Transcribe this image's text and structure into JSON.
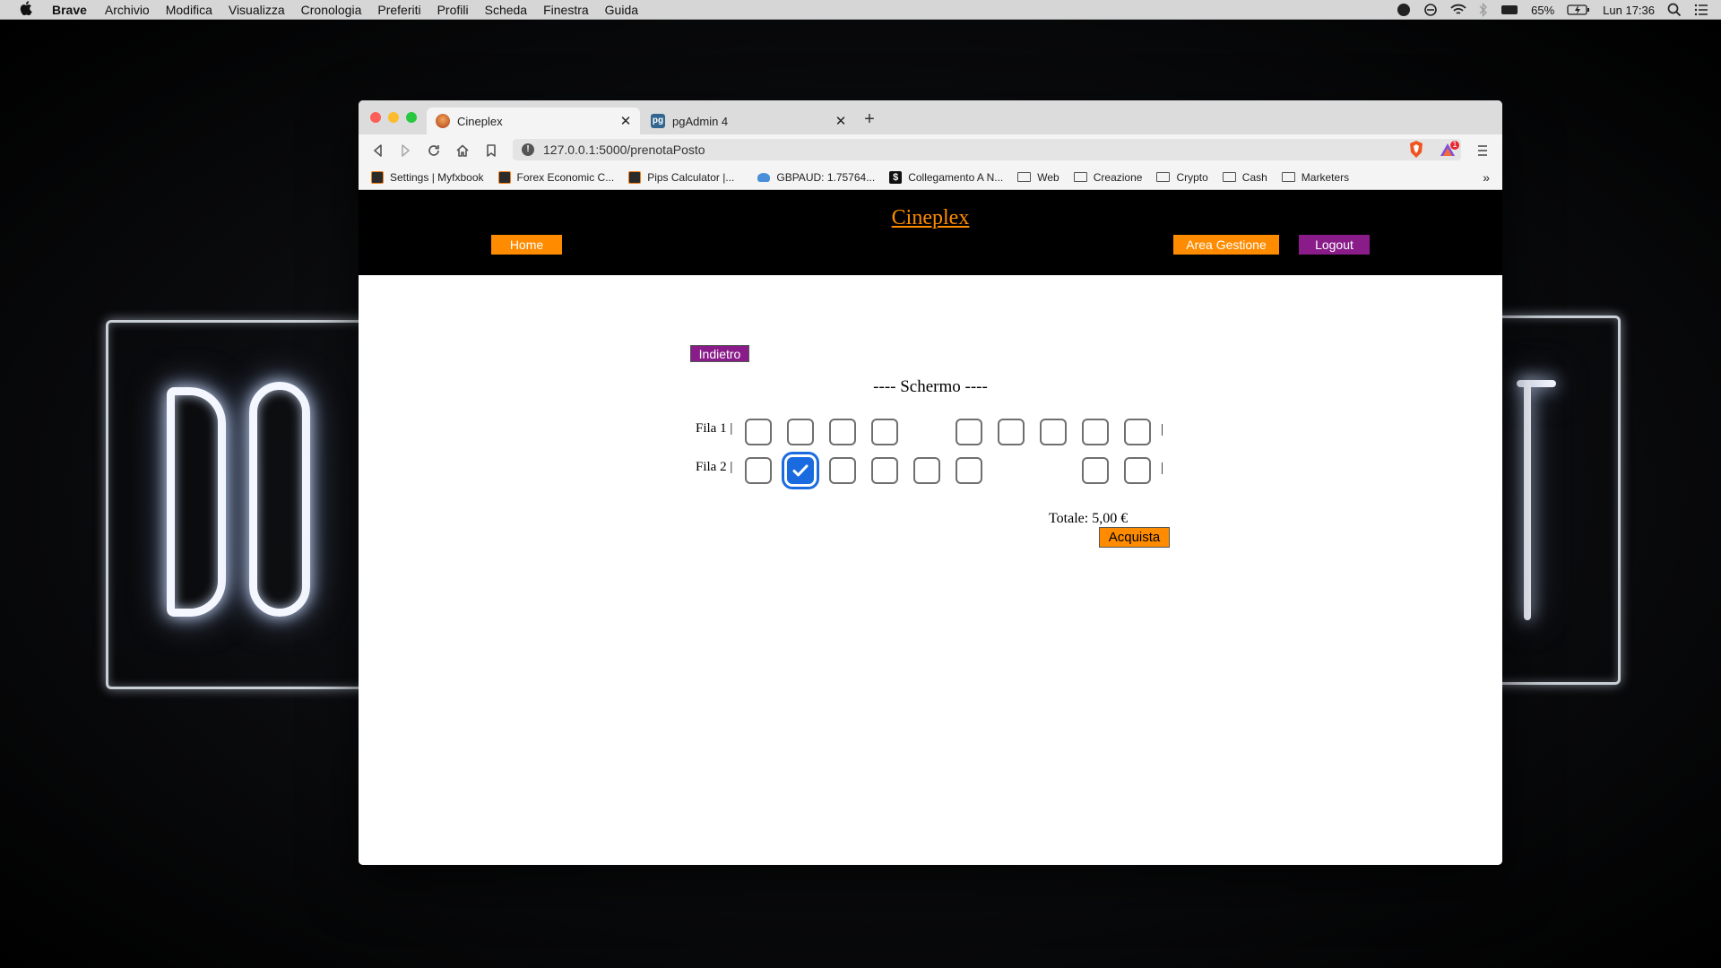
{
  "menubar": {
    "app_name": "Brave",
    "items": [
      "Archivio",
      "Modifica",
      "Visualizza",
      "Cronologia",
      "Preferiti",
      "Profili",
      "Scheda",
      "Finestra",
      "Guida"
    ],
    "battery": "65%",
    "clock": "Lun 17:36"
  },
  "browser": {
    "tabs": [
      {
        "title": "Cineplex",
        "favicon": "cineplex-favicon"
      },
      {
        "title": "pgAdmin 4",
        "favicon": "pgadmin-favicon"
      }
    ],
    "url": "127.0.0.1:5000/prenotaPosto",
    "notification_count": "1",
    "bookmarks": [
      {
        "label": "Settings | Myfxbook",
        "icon": "myfxbook-icon"
      },
      {
        "label": "Forex Economic C...",
        "icon": "myfxbook-icon"
      },
      {
        "label": "Pips Calculator |...",
        "icon": "myfxbook-icon"
      },
      {
        "label": "GBPAUD: 1.75764...",
        "icon": "cloud-icon"
      },
      {
        "label": "Collegamento A N...",
        "icon": "dollar-icon"
      },
      {
        "label": "Web",
        "icon": "folder-icon"
      },
      {
        "label": "Creazione",
        "icon": "folder-icon"
      },
      {
        "label": "Crypto",
        "icon": "folder-icon"
      },
      {
        "label": "Cash",
        "icon": "folder-icon"
      },
      {
        "label": "Marketers",
        "icon": "folder-icon"
      }
    ],
    "bookmarks_overflow": "»"
  },
  "site": {
    "title": "Cineplex",
    "nav": {
      "home": "Home",
      "admin": "Area Gestione",
      "logout": "Logout"
    },
    "colors": {
      "orange": "#ff8c00",
      "purple": "#8a1c8a",
      "selected_seat": "#1a6be0"
    }
  },
  "booking": {
    "back_label": "Indietro",
    "screen_label": "---- Schermo ----",
    "rows": [
      {
        "label": "Fila 1 |",
        "end": "|",
        "seats": [
          0,
          0,
          0,
          0,
          null,
          0,
          0,
          0,
          0,
          0
        ]
      },
      {
        "label": "Fila 2 |",
        "end": "|",
        "seats": [
          0,
          1,
          0,
          0,
          0,
          0,
          null,
          null,
          0,
          0
        ]
      }
    ],
    "total": "Totale: 5,00 €",
    "buy_label": "Acquista"
  }
}
